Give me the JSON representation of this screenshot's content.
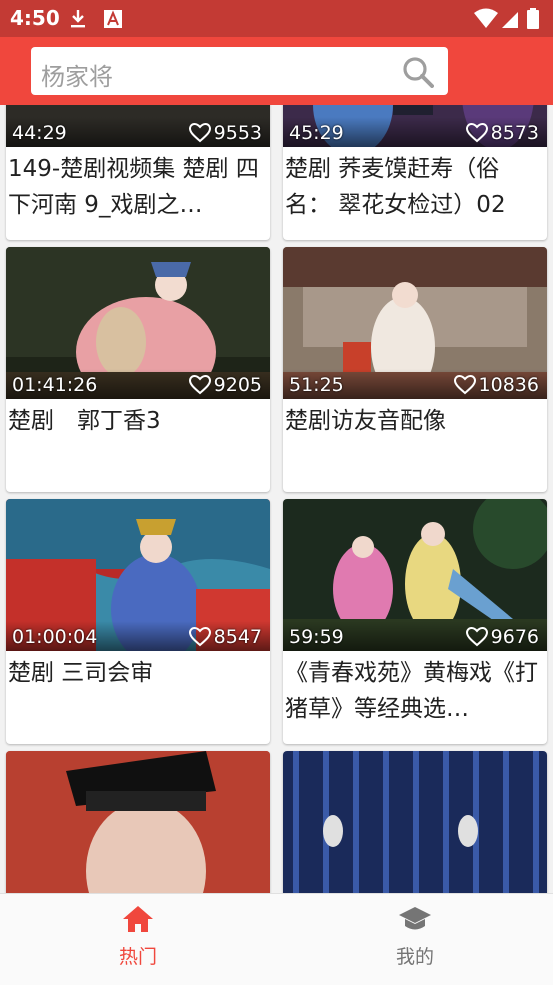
{
  "status_bar": {
    "time": "4:50"
  },
  "search": {
    "placeholder": "杨家将"
  },
  "videos": [
    {
      "duration": "44:29",
      "likes": "9553",
      "title": "149-楚剧视频集 楚剧 四下河南 9_戏剧之…"
    },
    {
      "duration": "45:29",
      "likes": "8573",
      "title": "楚剧 荞麦馍赶寿（俗名： 翠花女检过）02"
    },
    {
      "duration": "01:41:26",
      "likes": "9205",
      "title": "楚剧　郭丁香3"
    },
    {
      "duration": "51:25",
      "likes": "10836",
      "title": "楚剧访友音配像"
    },
    {
      "duration": "01:00:04",
      "likes": "8547",
      "title": "楚剧  三司会审"
    },
    {
      "duration": "59:59",
      "likes": "9676",
      "title": "《青春戏苑》黄梅戏《打猪草》等经典选…"
    },
    {
      "duration": "",
      "likes": "",
      "title": ""
    },
    {
      "duration": "",
      "likes": "",
      "title": ""
    }
  ],
  "bottom_nav": {
    "items": [
      {
        "label": "热门",
        "icon": "home-icon",
        "active": true
      },
      {
        "label": "我的",
        "icon": "graduation-cap-icon",
        "active": false
      }
    ]
  },
  "colors": {
    "accent": "#f0473d",
    "status_bar": "#c33a34"
  }
}
